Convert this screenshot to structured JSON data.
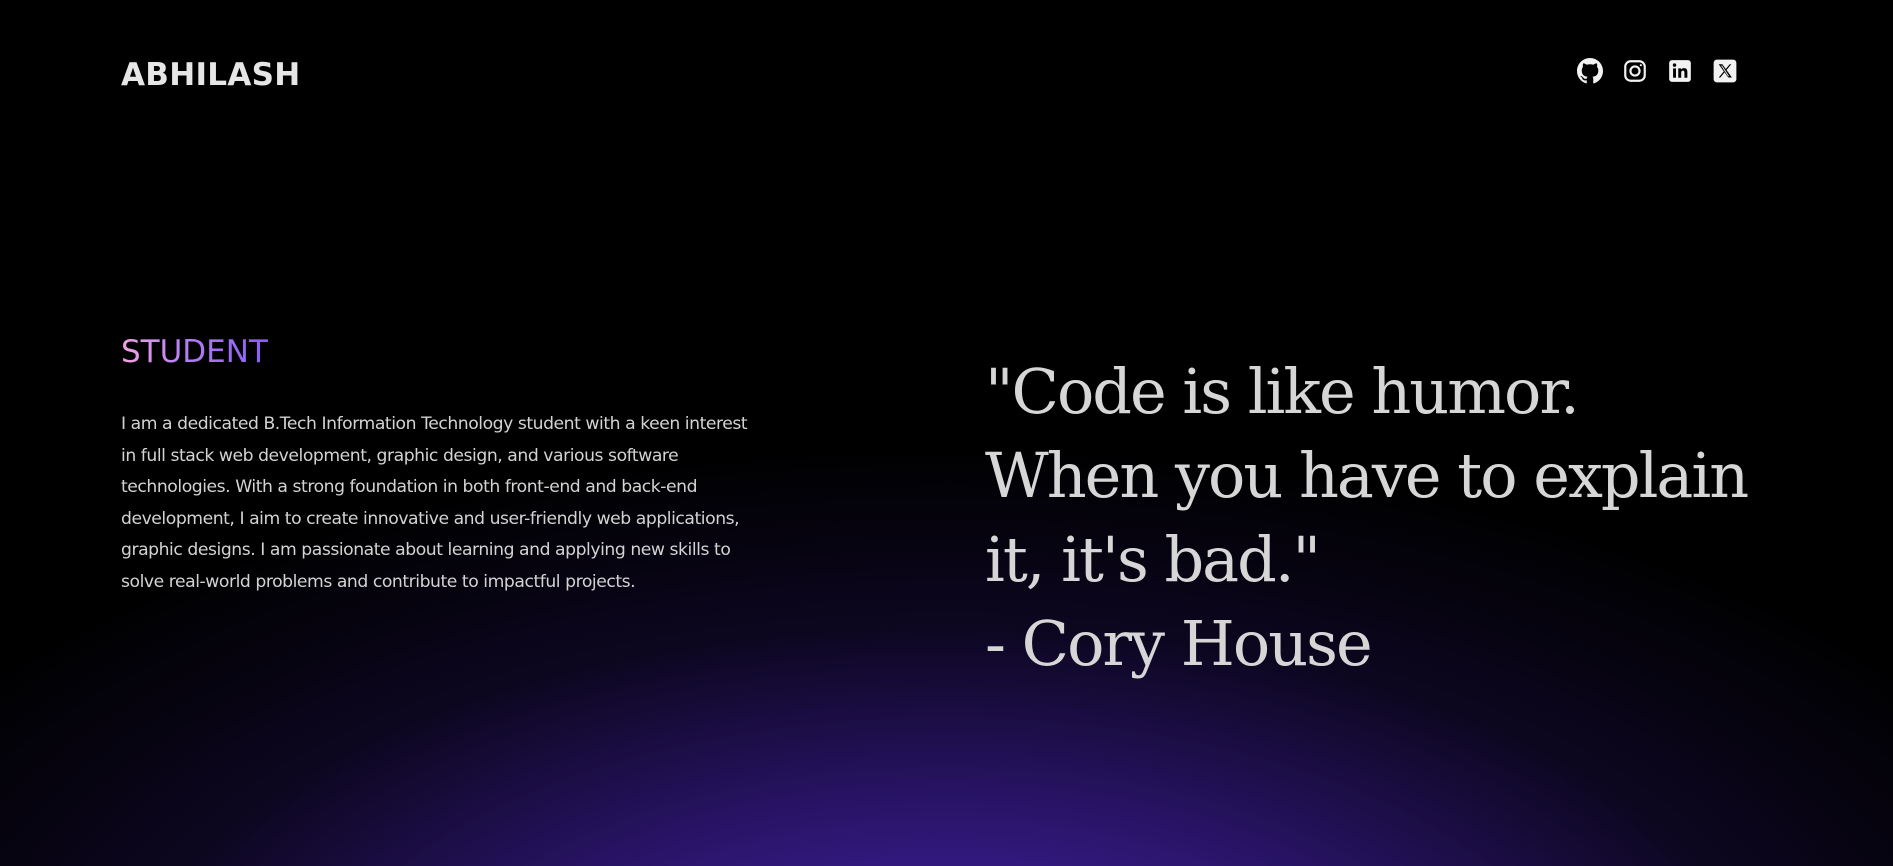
{
  "header": {
    "brand": "ABHILASH",
    "socials": [
      {
        "icon": "github-icon",
        "label": "GitHub"
      },
      {
        "icon": "instagram-icon",
        "label": "Instagram"
      },
      {
        "icon": "linkedin-icon",
        "label": "LinkedIn"
      },
      {
        "icon": "x-icon",
        "label": "X"
      }
    ]
  },
  "hero": {
    "role": "STUDENT",
    "about": "I am a dedicated B.Tech Information Technology student with a keen interest in full stack web development, graphic design, and various software technologies. With a strong foundation in both front-end and back-end development, I aim to create innovative and user-friendly web applications, graphic designs. I am passionate about learning and applying new skills to solve real-world problems and contribute to impactful projects.",
    "quote_lines": [
      "\"Code is like humor.",
      "When you have to explain",
      "it, it's bad.\"",
      "- Cory House"
    ]
  },
  "colors": {
    "background": "#000000",
    "glow": "#4e26be",
    "role_gradient_start": "#f3a3e3",
    "role_gradient_end": "#8a5cf6",
    "text": "#d9d9d9"
  }
}
